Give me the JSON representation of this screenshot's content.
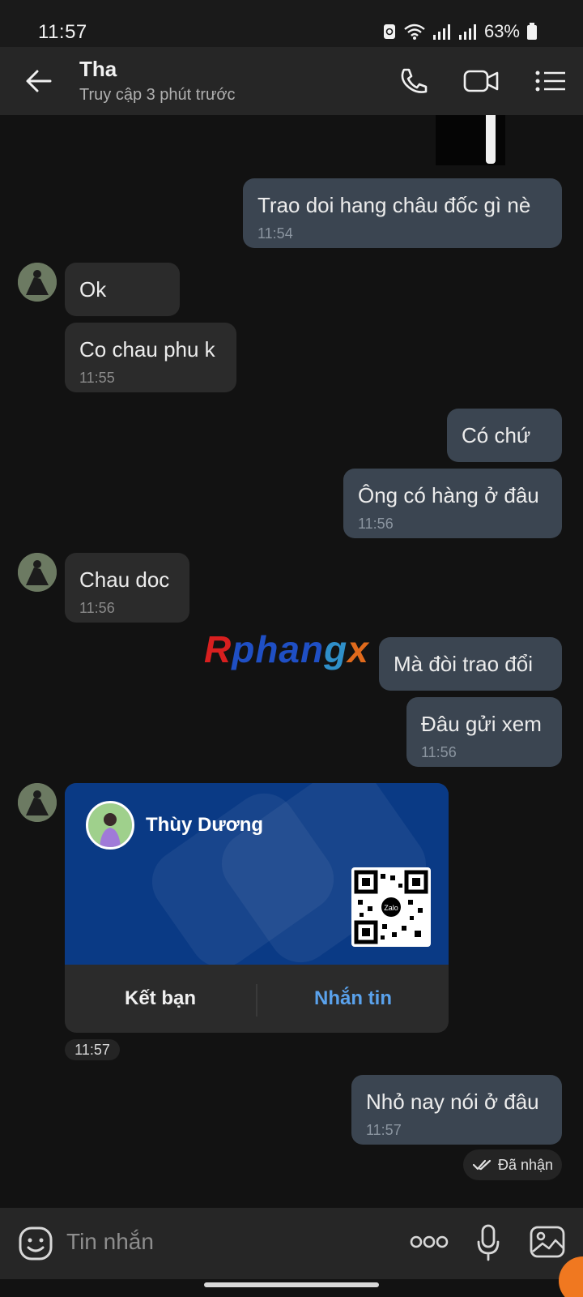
{
  "status_bar": {
    "time": "11:57",
    "battery": "63%"
  },
  "header": {
    "title": "Tha",
    "subtitle": "Truy cập 3 phút trước"
  },
  "messages": {
    "m1": {
      "text": "Trao doi hang châu đốc gì nè",
      "time": "11:54"
    },
    "m2": {
      "text": "Ok"
    },
    "m3": {
      "text": "Co chau phu k",
      "time": "11:55"
    },
    "m4": {
      "text": "Có chứ"
    },
    "m5": {
      "text": "Ông có hàng ở đâu",
      "time": "11:56"
    },
    "m6": {
      "text": "Chau doc",
      "time": "11:56"
    },
    "m7": {
      "text": "Mà đòi trao đổi"
    },
    "m8": {
      "text": "Đâu gửi xem",
      "time": "11:56"
    },
    "m9": {
      "text": "Nhỏ nay nói ở đâu",
      "time": "11:57"
    }
  },
  "contact_card": {
    "name": "Thùy Dương",
    "add_friend_label": "Kết bạn",
    "message_label": "Nhắn tin",
    "qr_label": "Zalo",
    "time": "11:57"
  },
  "delivery_status": "Đã nhận",
  "watermark": {
    "p1": "R",
    "p2": "phan",
    "p3": "g",
    "p4": "x"
  },
  "composer": {
    "placeholder": "Tin nhắn"
  },
  "colors": {
    "accent": "#5aa2ec",
    "card_bg": "#0a3a85",
    "outgoing_bubble": "#3b4551",
    "incoming_bubble": "#2b2b2b"
  }
}
